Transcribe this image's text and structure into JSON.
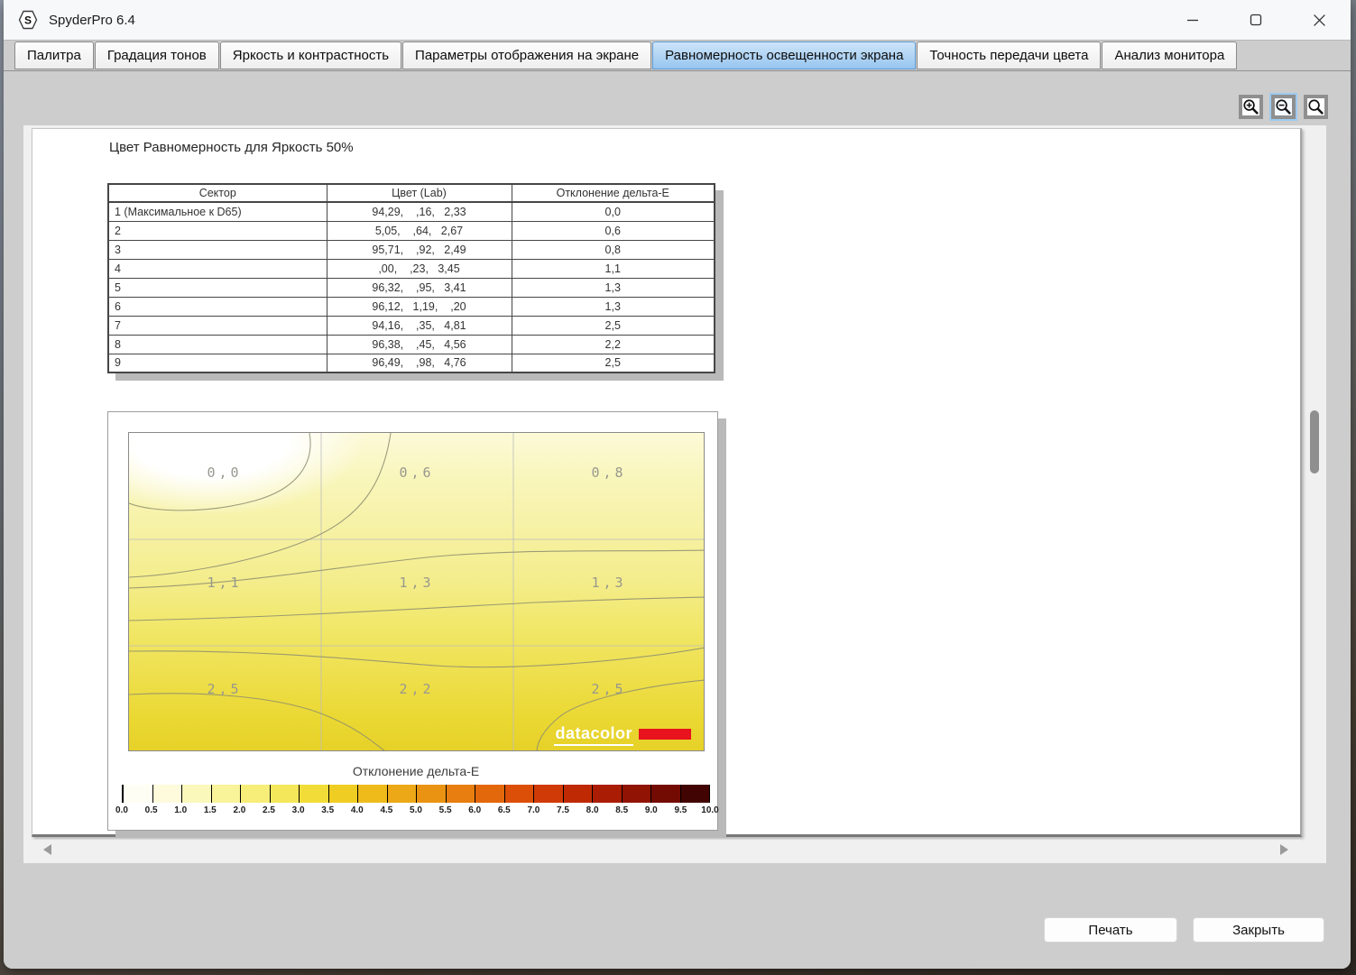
{
  "window": {
    "title": "SpyderPro 6.4"
  },
  "tabs": [
    {
      "label": "Палитра",
      "active": false
    },
    {
      "label": "Градация тонов",
      "active": false
    },
    {
      "label": "Яркость и контрастность",
      "active": false
    },
    {
      "label": "Параметры отображения на экране",
      "active": false
    },
    {
      "label": "Равномерность освещенности экрана",
      "active": true
    },
    {
      "label": "Точность передачи цвета",
      "active": false
    },
    {
      "label": "Анализ монитора",
      "active": false
    }
  ],
  "report": {
    "title": "Цвет Равномерность для Яркость 50%",
    "table": {
      "headers": [
        "Сектор",
        "Цвет (Lab)",
        "Отклонение дельта-E"
      ],
      "rows": [
        {
          "sector": "1 (Максимальное к D65)",
          "lab": "94,29,    ,16,   2,33",
          "delta": "0,0"
        },
        {
          "sector": "2",
          "lab": "5,05,    ,64,   2,67",
          "delta": "0,6"
        },
        {
          "sector": "3",
          "lab": "95,71,    ,92,   2,49",
          "delta": "0,8"
        },
        {
          "sector": "4",
          "lab": ",00,    ,23,   3,45",
          "delta": "1,1"
        },
        {
          "sector": "5",
          "lab": "96,32,    ,95,   3,41",
          "delta": "1,3"
        },
        {
          "sector": "6",
          "lab": "96,12,   1,19,    ,20",
          "delta": "1,3"
        },
        {
          "sector": "7",
          "lab": "94,16,    ,35,   4,81",
          "delta": "2,5"
        },
        {
          "sector": "8",
          "lab": "96,38,    ,45,   4,56",
          "delta": "2,2"
        },
        {
          "sector": "9",
          "lab": "96,49,    ,98,   4,76",
          "delta": "2,5"
        }
      ]
    },
    "heatmap": {
      "logo_text": "datacolor",
      "logo_bar_color": "#e8131d",
      "scale_title": "Отклонение дельта-E",
      "scale_labels": [
        "0.0",
        "0.5",
        "1.0",
        "1.5",
        "2.0",
        "2.5",
        "3.0",
        "3.5",
        "4.0",
        "4.5",
        "5.0",
        "5.5",
        "6.0",
        "6.5",
        "7.0",
        "7.5",
        "8.0",
        "8.5",
        "9.0",
        "9.5",
        "10.0"
      ],
      "scale_colors": [
        "#fffef4",
        "#fdfbdc",
        "#fbf8bc",
        "#f9f39a",
        "#f7ee79",
        "#f5e75a",
        "#f2dd38",
        "#f0cd22",
        "#eebb1b",
        "#eca816",
        "#ea9312",
        "#e77e0f",
        "#e3670b",
        "#dc4f08",
        "#d03a06",
        "#bf2a05",
        "#aa1d04",
        "#911303",
        "#730b02",
        "#420402"
      ]
    }
  },
  "chart_data": {
    "type": "heatmap",
    "title": "Цвет Равномерность для Яркость 50%",
    "rows": 3,
    "cols": 3,
    "values": [
      [
        0.0,
        0.6,
        0.8
      ],
      [
        1.1,
        1.3,
        1.3
      ],
      [
        2.5,
        2.2,
        2.5
      ]
    ],
    "scale_label": "Отклонение дельта-E",
    "scale_range": [
      0.0,
      10.0
    ],
    "scale_step": 0.5,
    "legend_position": "bottom"
  },
  "buttons": {
    "print": "Печать",
    "close": "Закрыть"
  }
}
